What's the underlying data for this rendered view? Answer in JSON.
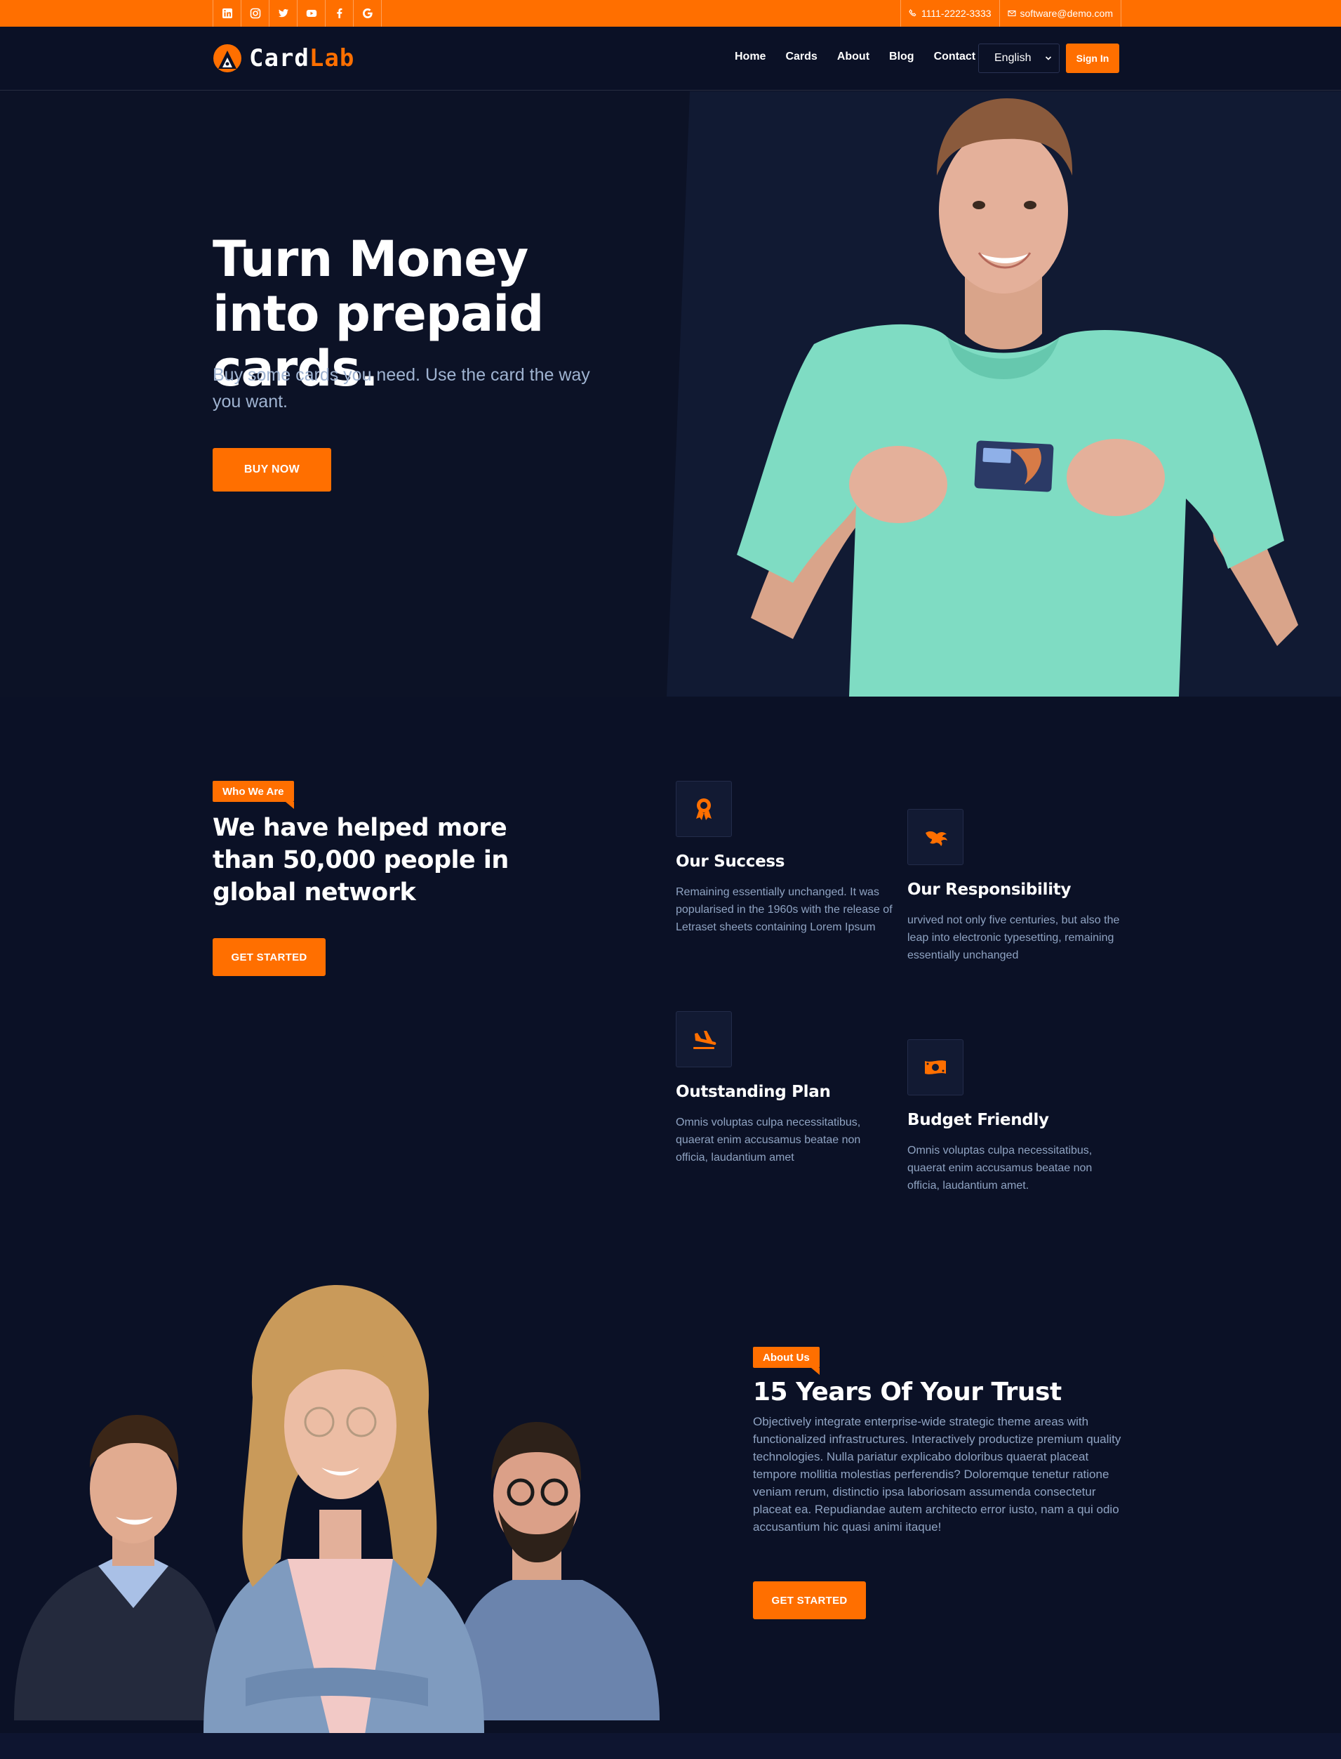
{
  "topbar": {
    "social_icons": [
      "linkedin-icon",
      "instagram-icon",
      "twitter-icon",
      "youtube-icon",
      "facebook-icon",
      "google-icon"
    ],
    "phone": "1111-2222-3333",
    "email": "software@demo.com"
  },
  "header": {
    "logo_part1": "Card",
    "logo_part2": "Lab",
    "nav": [
      "Home",
      "Cards",
      "About",
      "Blog",
      "Contact"
    ],
    "language": "English",
    "signin_label": "Sign In"
  },
  "hero": {
    "title": "Turn Money into prepaid cards.",
    "subtitle": "Buy some cards you need. Use the card the way you want.",
    "button_label": "BUY NOW"
  },
  "who": {
    "tag": "Who We Are",
    "title": "We have helped more than 50,000 people in global network",
    "button_label": "GET STARTED",
    "features": [
      {
        "icon": "award-icon",
        "title": "Our Success",
        "text": "Remaining essentially unchanged. It was popularised in the 1960s with the release of Letraset sheets containing Lorem Ipsum"
      },
      {
        "icon": "phoenix-icon",
        "title": "Our Responsibility",
        "text": "urvived not only five centuries, but also the leap into electronic typesetting, remaining essentially unchanged"
      },
      {
        "icon": "plane-landing-icon",
        "title": "Outstanding Plan",
        "text": "Omnis voluptas culpa necessitatibus, quaerat enim accusamus beatae non officia, laudantium amet"
      },
      {
        "icon": "money-bill-icon",
        "title": "Budget Friendly",
        "text": "Omnis voluptas culpa necessitatibus, quaerat enim accusamus beatae non officia, laudantium amet."
      }
    ]
  },
  "about": {
    "tag": "About Us",
    "title": "15 Years Of Your Trust",
    "text": "Objectively integrate enterprise-wide strategic theme areas with functionalized infrastructures. Interactively productize premium quality technologies. Nulla pariatur explicabo doloribus quaerat placeat tempore mollitia molestias perferendis? Doloremque tenetur ratione veniam rerum, distinctio ipsa laboriosam assumenda consectetur placeat ea. Repudiandae autem architecto error iusto, nam a qui odio accusantium hic quasi animi itaque!",
    "button_label": "GET STARTED"
  },
  "colors": {
    "accent": "#ff6f00",
    "background": "#0b1126",
    "muted_text": "#8fa3c2"
  }
}
